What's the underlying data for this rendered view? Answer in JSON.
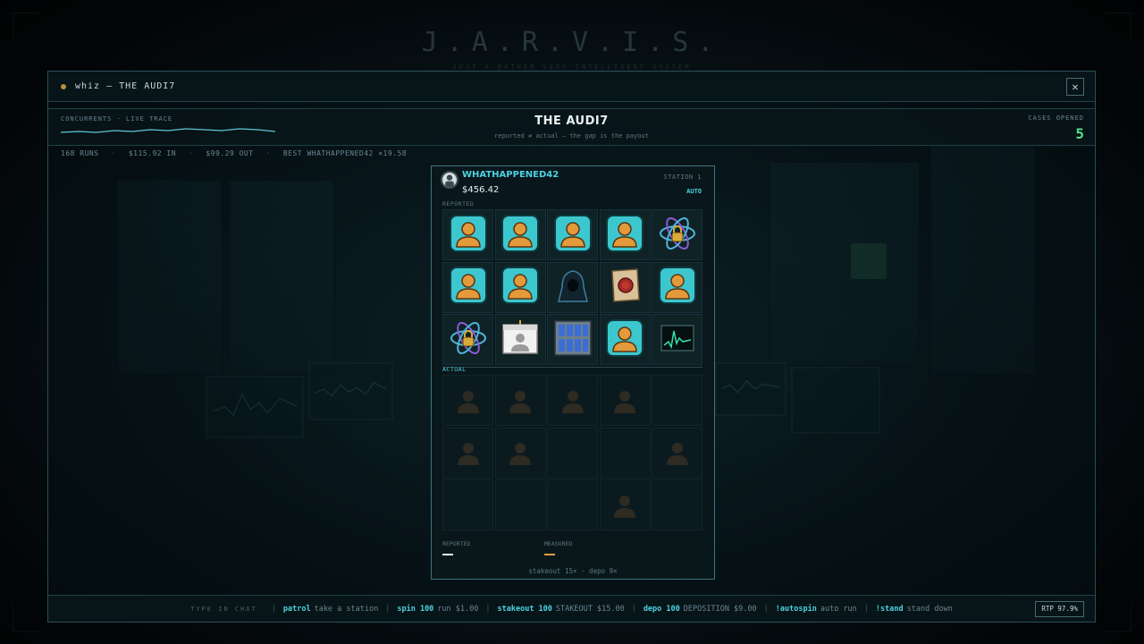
{
  "brand": {
    "title": "J.A.R.V.I.S.",
    "subtitle": "JUST A RATHER VERY INTELLIGENT SYSTEM"
  },
  "window": {
    "title": "whiz — THE AUDI7",
    "close_icon": "close-icon"
  },
  "header": {
    "concurrents_label": "CONCURRENTS · LIVE TRACE",
    "game_title": "THE AUDI7",
    "game_subtitle": "reported ≠ actual — the gap is the payout",
    "cases_label": "CASES OPENED",
    "cases_value": "5"
  },
  "stats": {
    "runs": "168 RUNS",
    "in": "$115.92 IN",
    "out": "$99.29 OUT",
    "best": "BEST WHATHAPPENED42 ×19.58"
  },
  "station": {
    "player": "WHATHAPPENED42",
    "balance": "$456.42",
    "station_label": "STATION 1",
    "mode": "AUTO",
    "reported_label": "REPORTED",
    "actual_label": "ACTUAL",
    "reported_grid": [
      "person-card-icon",
      "person-card-icon",
      "person-card-icon",
      "person-card-icon",
      "atom-lock-icon",
      "person-card-icon",
      "person-card-icon",
      "hooded-figure-icon",
      "sealed-document-icon",
      "person-card-icon",
      "atom-lock-icon",
      "id-badge-icon",
      "server-rack-icon",
      "person-card-icon",
      "chart-monitor-icon"
    ],
    "actual_grid": [
      "person-silhouette-icon",
      "person-silhouette-icon",
      "person-silhouette-icon",
      "person-silhouette-icon",
      "",
      "person-silhouette-icon",
      "person-silhouette-icon",
      "",
      "",
      "person-silhouette-icon",
      "",
      "",
      "",
      "person-silhouette-icon",
      ""
    ],
    "footer_reported": "REPORTED",
    "footer_measured": "MEASURED",
    "footer_line": "stakeout 15×   ·   depo 9×",
    "colors": {
      "reported_bar": "#e8f0f2",
      "measured_bar": "#e0a040"
    }
  },
  "commands": {
    "label": "TYPE IN CHAT",
    "items": [
      {
        "cmd": "patrol",
        "desc": "take a station"
      },
      {
        "cmd": "spin 100",
        "desc": "run $1.00"
      },
      {
        "cmd": "stakeout 100",
        "desc": "STAKEOUT $15.00"
      },
      {
        "cmd": "depo 100",
        "desc": "DEPOSITION $9.00"
      },
      {
        "cmd": "!autospin",
        "desc": "auto run"
      },
      {
        "cmd": "!stand",
        "desc": "stand down"
      }
    ],
    "rtp": "RTP 97.9%"
  },
  "colors": {
    "accent": "#4fd1e0",
    "cases": "#53e08a",
    "gold_dot": "#b98d3a"
  }
}
